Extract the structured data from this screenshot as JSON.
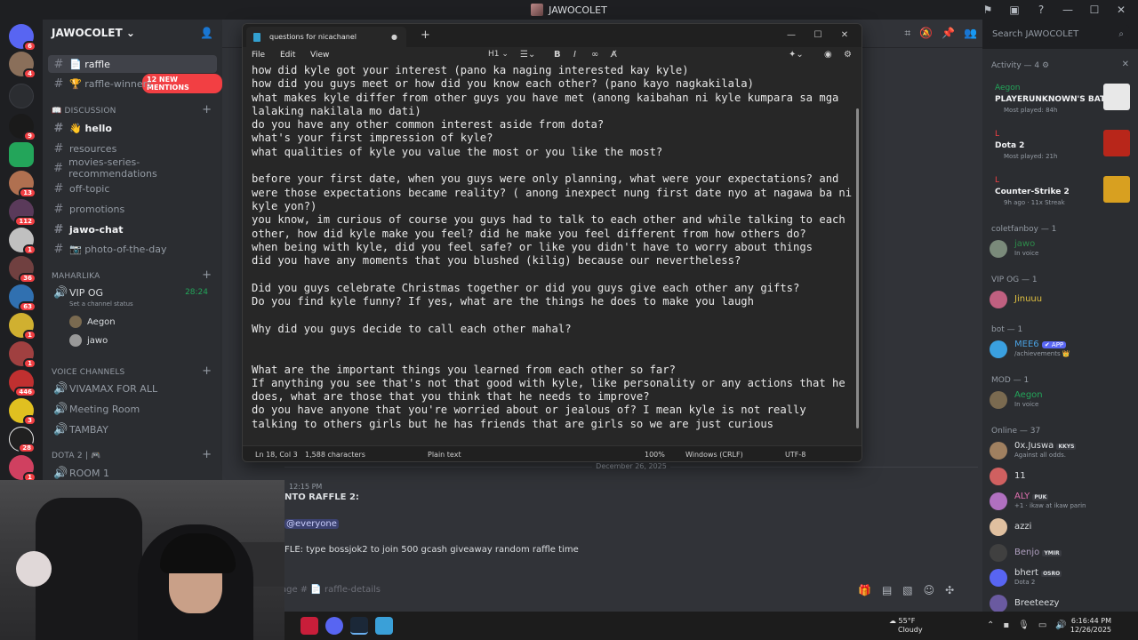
{
  "window": {
    "title": "JAWOCOLET"
  },
  "guild": {
    "name": "JAWOCOLET",
    "mentions_pill": "12 NEW MENTIONS"
  },
  "server_badges": [
    "6",
    "4",
    "9",
    "13",
    "112",
    "1",
    "36",
    "63",
    "1",
    "1",
    "446",
    "3",
    "28",
    "1"
  ],
  "sidebar": {
    "top_channels": [
      {
        "label": "📄 raffle",
        "name": "raffle-details"
      },
      {
        "label": "🏆 raffle-winners",
        "name": "raffle-winners"
      }
    ],
    "cat_discussion": "📖 DISCUSSION",
    "discussion": [
      {
        "label": "👋 hello",
        "unread": true
      },
      {
        "label": "resources"
      },
      {
        "label": "movies-series-recommendations"
      },
      {
        "label": "off-topic"
      },
      {
        "label": "promotions"
      },
      {
        "label": "jawo-chat",
        "unread": true
      },
      {
        "label": "📷 photo-of-the-day"
      }
    ],
    "cat_maharlika": "MAHARLIKA",
    "vip_channel": {
      "label": "VIP OG",
      "timer": "28:24",
      "status": "Set a channel status"
    },
    "vc_users": [
      "Aegon",
      "jawo"
    ],
    "cat_voice": "Voice Channels",
    "voice": [
      "VIVAMAX FOR ALL",
      "Meeting Room",
      "TAMBAY"
    ],
    "cat_dota": "DOTA 2 | 🎮",
    "room": "ROOM 1"
  },
  "search": {
    "placeholder": "Search JAWOCOLET"
  },
  "notepad": {
    "tab_title": "questions for nicachanel",
    "menus": [
      "File",
      "Edit",
      "View"
    ],
    "heading_btn": "H1",
    "lines": [
      "how did kyle got your interest (pano ka naging interested kay kyle)",
      "how did you guys meet or how did you know each other? (pano kayo nagkakilala)",
      "what makes kyle differ from other guys you have met (anong kaibahan ni kyle kumpara sa mga",
      "lalaking nakilala mo dati)",
      "do you have any other common interest aside from dota?",
      "what's your first impression of kyle?",
      "what qualities of kyle you value the most or you like the most?",
      "",
      "before your first date, when you guys were only planning, what were your expectations? and",
      "were those expectations became reality? ( anong inexpect nung first date nyo at nagawa ba ni",
      "kyle yon?)",
      "you know, im curious of course you guys had to talk to each other and while talking to each",
      "other, how did kyle make you feel? did he make you feel different from how others do?",
      "when being with kyle, did you feel safe? or like you didn't have to worry about things",
      "did you have any moments that you blushed (kilig) because our nevertheless?",
      "",
      "Did you guys celebrate Christmas together or did you guys give each other any gifts?",
      "Do you find kyle funny? If yes, what are the things he does to make you laugh",
      "",
      "Why did you guys decide to call each other mahal?",
      "",
      "",
      "What are the important things you learned from each other so far?",
      "If anything you see that's not that good with kyle, like personality or any actions that he",
      "does, what are those that you think that he needs to improve?",
      "do you have anyone that you're worried about or jealous of? I mean kyle is not really",
      "talking to others girls but he has friends that are girls so we are just curious"
    ],
    "status": {
      "position": "Ln 18, Col 3",
      "chars": "1,588 characters",
      "format": "Plain text",
      "zoom": "100%",
      "eol": "Windows (CRLF)",
      "encoding": "UTF-8"
    }
  },
  "chat": {
    "date": "December 26, 2025",
    "time": "12:15 PM",
    "line1": "NTO RAFFLE 2:",
    "mention": "@everyone",
    "line3": "FLE: type bossjok2 to join 500 gcash giveaway random raffle time",
    "composer": "age # 📄 raffle-details"
  },
  "members": {
    "activity_header": "Activity — 4 ⚙",
    "activities": [
      {
        "user": "Aegon",
        "game": "PLAYERUNKNOWN'S BAT...",
        "sub": "Most played: 84h",
        "color": "#23a55a"
      },
      {
        "user": "L",
        "game": "Dota 2",
        "sub": "Most played: 21h",
        "color": "#f23f43"
      },
      {
        "user": "L",
        "game": "Counter-Strike 2",
        "sub": "9h ago · 11x Streak",
        "color": "#f23f43"
      }
    ],
    "sections": {
      "coletfanboy": "coletfanboy — 1",
      "vipog": "VIP OG — 1",
      "bot": "bot — 1",
      "mod": "MOD — 1",
      "online": "Online — 37"
    },
    "coletfanboy_user": {
      "name": "jawo",
      "status": "In voice"
    },
    "vip_user": {
      "name": "Jinuuu"
    },
    "bot_user": {
      "name": "MEE6",
      "tag": "✔ APP",
      "status": "/achievements 👑"
    },
    "mod_user": {
      "name": "Aegon",
      "status": "In voice"
    },
    "online_users": [
      {
        "name": "0x.Juswa",
        "tag": "KKYS",
        "status": "Against all odds."
      },
      {
        "name": "11",
        "tag": "",
        "status": ""
      },
      {
        "name": "ALY",
        "tag": "PUK",
        "status": "+1 · ikaw at ikaw parin"
      },
      {
        "name": "azzi",
        "tag": "",
        "status": ""
      },
      {
        "name": "Benjo",
        "tag": "YMIR",
        "status": ""
      },
      {
        "name": "bhert",
        "tag": "OSRO",
        "status": "Dota 2"
      },
      {
        "name": "Breeteezy",
        "tag": "",
        "status": ""
      }
    ]
  },
  "taskbar": {
    "temp": "55°F",
    "weather": "Cloudy",
    "time": "6:16:44 PM",
    "date": "12/26/2025"
  }
}
